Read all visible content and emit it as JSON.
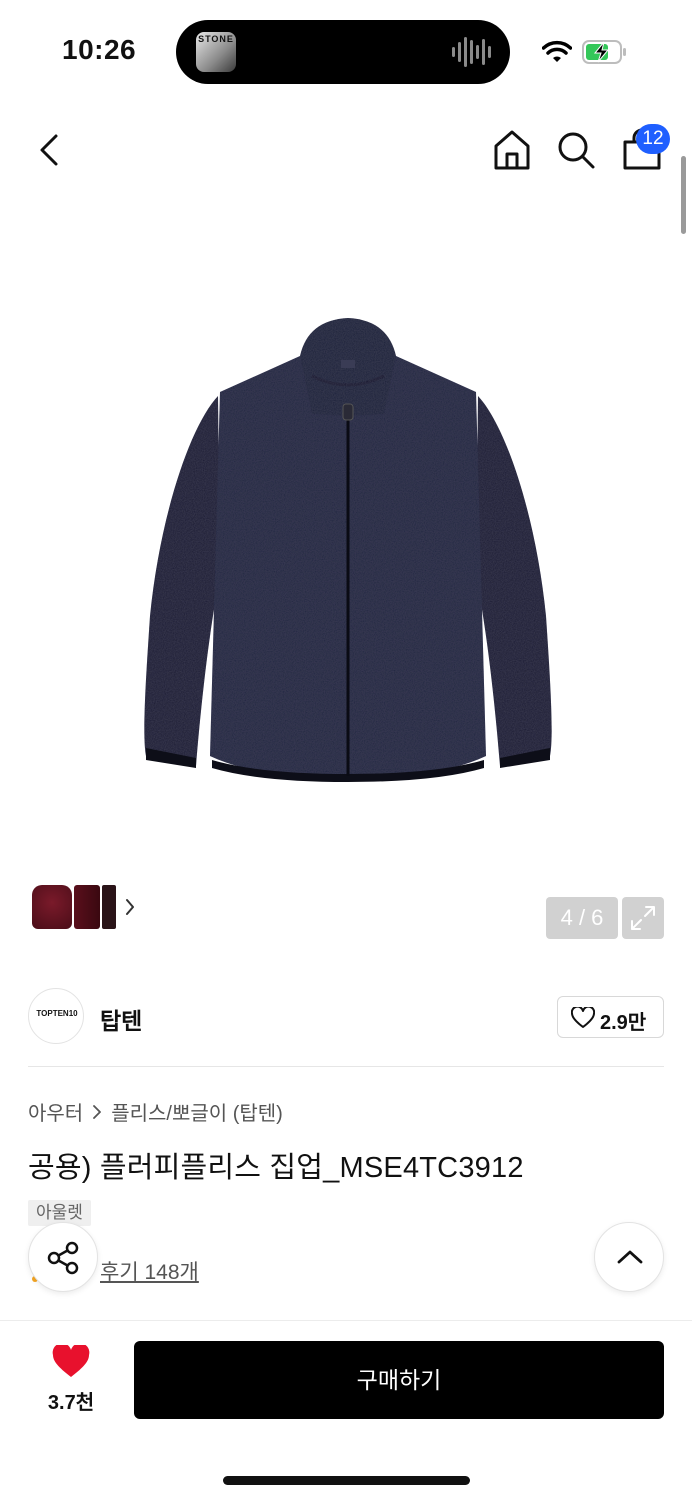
{
  "status_bar": {
    "time": "10:26",
    "now_playing_art_text": "STONE"
  },
  "nav": {
    "cart_count": "12"
  },
  "gallery": {
    "page_counter": "4 / 6"
  },
  "brand": {
    "logo_text": "TOPTEN10",
    "name": "탑텐",
    "like_count": "2.9만"
  },
  "product": {
    "breadcrumb": [
      "아우터",
      "플리스/뽀글이 (탑텐)"
    ],
    "title": "공용) 플러피플리스 집업_MSE4TC3912",
    "tag": "아울렛",
    "review_link": "후기 148개"
  },
  "bottom_bar": {
    "wish_count": "3.7천",
    "buy_label": "구매하기"
  },
  "colors": {
    "accent_blue": "#1f5fff",
    "heart_red": "#e8112d",
    "buy_button": "#000000"
  }
}
